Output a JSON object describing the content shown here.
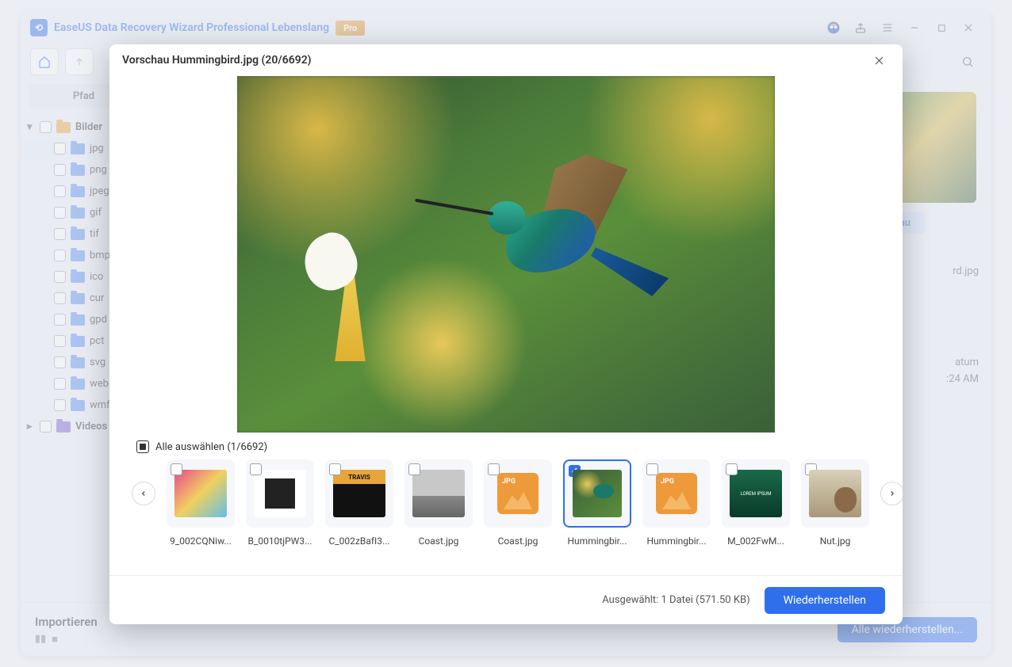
{
  "titlebar": {
    "app_title": "EaseUS Data Recovery Wizard Professional Lebenslang",
    "pro_label": "Pro"
  },
  "sidebar": {
    "header": "Pfad",
    "root_bilder": "Bilder",
    "items": [
      "jpg",
      "png",
      "jpeg",
      "gif",
      "tif",
      "bmp",
      "ico",
      "cur",
      "gpd",
      "pct",
      "svg",
      "webp",
      "wmf"
    ],
    "root_videos": "Videos"
  },
  "bottom": {
    "import_label": "Importieren",
    "recover_all": "Alle wiederherstellen..."
  },
  "right_panel": {
    "preview_btn": "Vorschau",
    "filename_suffix": "rd.jpg",
    "meta_hint1": "atum",
    "meta_hint2": ":24 AM"
  },
  "modal": {
    "title": "Vorschau Hummingbird.jpg (20/6692)",
    "select_all": "Alle auswählen (1/6692)",
    "thumbs": [
      {
        "label": "9_002CQNiw...",
        "selected": false,
        "type": "colorful"
      },
      {
        "label": "B_0010tjPW3...",
        "selected": false,
        "type": "bw"
      },
      {
        "label": "C_002zBafI3...",
        "selected": false,
        "type": "travis"
      },
      {
        "label": "Coast.jpg",
        "selected": false,
        "type": "coast"
      },
      {
        "label": "Coast.jpg",
        "selected": false,
        "type": "jpgicon"
      },
      {
        "label": "Hummingbir...",
        "selected": true,
        "type": "humming",
        "border": true
      },
      {
        "label": "Hummingbir...",
        "selected": false,
        "type": "jpgicon"
      },
      {
        "label": "M_002FwM...",
        "selected": false,
        "type": "m002"
      },
      {
        "label": "Nut.jpg",
        "selected": false,
        "type": "nut"
      }
    ],
    "footer_selected": "Ausgewählt: 1 Datei (571.50 KB)",
    "restore": "Wiederherstellen"
  }
}
